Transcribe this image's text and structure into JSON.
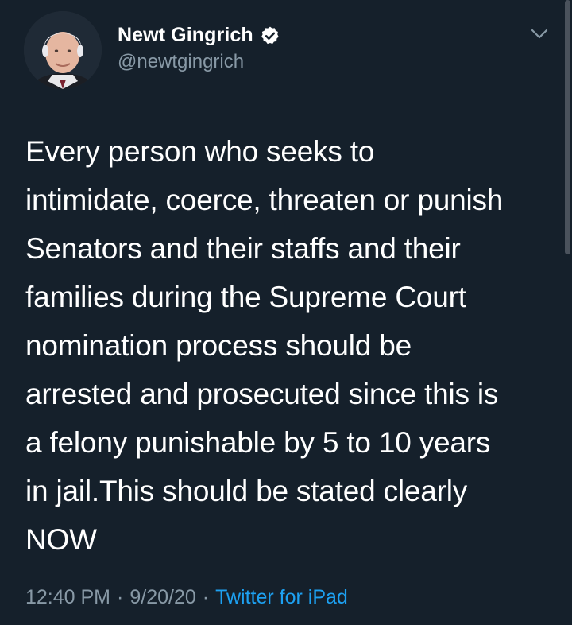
{
  "author": {
    "display_name": "Newt Gingrich",
    "handle": "@newtgingrich",
    "avatar_icon": "profile-photo",
    "verified_icon": "verified-badge-icon"
  },
  "tweet": {
    "text": "Every person who seeks to\nintimidate, coerce, threaten or punish\nSenators and their staffs and their\nfamilies during the Supreme Court\nnomination process should be\narrested and prosecuted since this is\na felony punishable by 5 to 10 years\nin jail.This should be stated clearly\nNOW"
  },
  "meta": {
    "time": "12:40 PM",
    "separator": "·",
    "date": "9/20/20",
    "source": "Twitter for iPad"
  },
  "colors": {
    "background": "#15202b",
    "text": "#ffffff",
    "secondary": "#8899a6",
    "link": "#1da1f2"
  }
}
